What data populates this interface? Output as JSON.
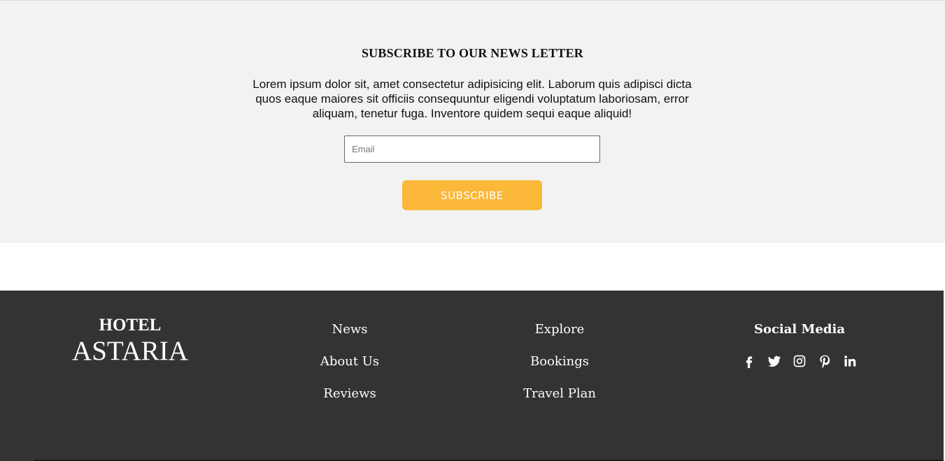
{
  "newsletter": {
    "title": "SUBSCRIBE TO OUR NEWS LETTER",
    "text": "Lorem ipsum dolor sit, amet consectetur adipisicing elit. Laborum quis adipisci dicta quos eaque maiores sit officiis consequuntur eligendi voluptatum laboriosam, error aliquam, tenetur fuga. Inventore quidem sequi eaque aliquid!",
    "email_placeholder": "Email",
    "email_value": "",
    "subscribe_label": "SUBSCRIBE",
    "accent_color": "#fbb839"
  },
  "footer": {
    "brand_top": "HOTEL",
    "brand_main": "ASTARIA",
    "links_col1": [
      "News",
      "About Us",
      "Reviews"
    ],
    "links_col2": [
      "Explore",
      "Bookings",
      "Travel Plan"
    ],
    "social_title": "Social Media",
    "social_icons": [
      "facebook-icon",
      "twitter-icon",
      "instagram-icon",
      "pinterest-icon",
      "linkedin-icon"
    ],
    "background_color": "#333333"
  }
}
